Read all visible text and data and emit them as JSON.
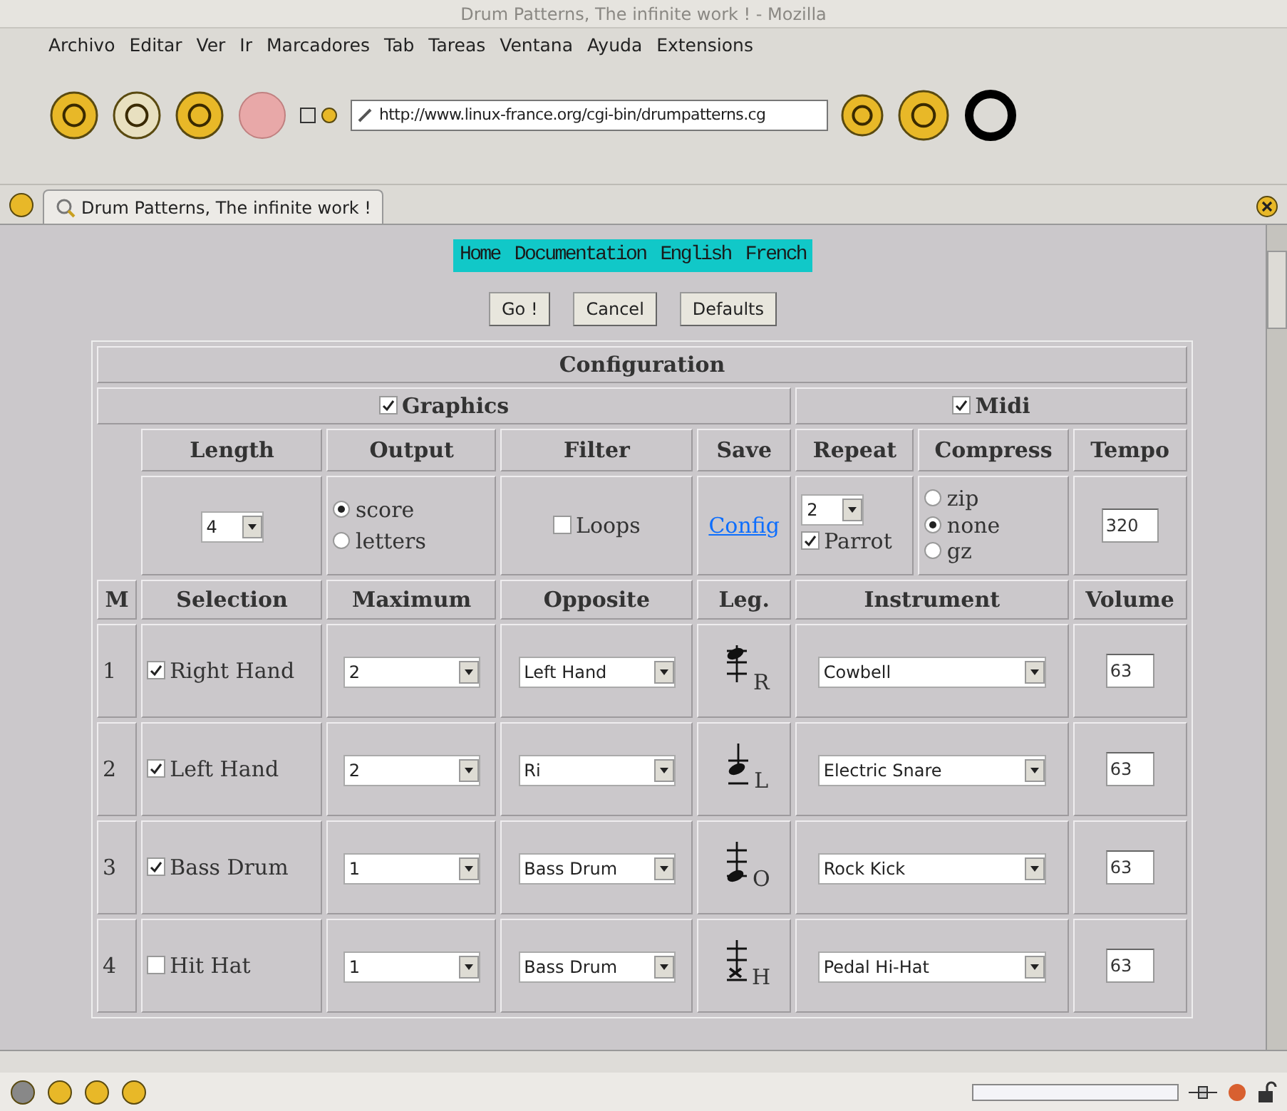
{
  "window": {
    "title": "Drum Patterns, The infinite work ! - Mozilla"
  },
  "menu": [
    "Archivo",
    "Editar",
    "Ver",
    "Ir",
    "Marcadores",
    "Tab",
    "Tareas",
    "Ventana",
    "Ayuda",
    "Extensions"
  ],
  "address_bar": {
    "url": "http://www.linux-france.org/cgi-bin/drumpatterns.cg"
  },
  "tabs": [
    {
      "label": "Drum Patterns, The infinite work !",
      "selected": true
    }
  ],
  "nav_links": [
    "Home",
    "Documentation",
    "English",
    "French"
  ],
  "buttons": [
    "Go !",
    "Cancel",
    "Defaults"
  ],
  "configuration": {
    "title": "Configuration",
    "sections": [
      {
        "label": "Graphics",
        "checked": true
      },
      {
        "label": "Midi",
        "checked": true
      }
    ],
    "columns": [
      "Length",
      "Output",
      "Filter",
      "Save",
      "Repeat",
      "Compress",
      "Tempo"
    ],
    "length": "4",
    "output": [
      {
        "label": "score",
        "selected": true
      },
      {
        "label": "letters",
        "selected": false
      }
    ],
    "filter": {
      "label": "Loops",
      "checked": false
    },
    "save_link": "Config",
    "repeat": "2",
    "parrot": {
      "label": "Parrot",
      "checked": true
    },
    "compress": [
      {
        "label": "zip",
        "selected": false
      },
      {
        "label": "none",
        "selected": true
      },
      {
        "label": "gz",
        "selected": false
      }
    ],
    "tempo": "320"
  },
  "tracks": {
    "columns": [
      "M",
      "Selection",
      "Maximum",
      "Opposite",
      "Leg.",
      "Instrument",
      "Volume"
    ],
    "rows": [
      {
        "number": "1",
        "label": "Right Hand",
        "checked": true,
        "maximum": "2",
        "opposite": "Left Hand",
        "legend": {
          "kind": "upper",
          "letter": "R"
        },
        "instrument": "Cowbell",
        "volume": "63"
      },
      {
        "number": "2",
        "label": "Left Hand",
        "checked": true,
        "maximum": "2",
        "opposite": "Ri",
        "legend": {
          "kind": "middle",
          "letter": "L"
        },
        "instrument": "Electric Snare",
        "volume": "63"
      },
      {
        "number": "3",
        "label": "Bass Drum",
        "checked": true,
        "maximum": "1",
        "opposite": "Bass Drum",
        "legend": {
          "kind": "lower",
          "letter": "O"
        },
        "instrument": "Rock Kick",
        "volume": "63"
      },
      {
        "number": "4",
        "label": "Hit Hat",
        "checked": false,
        "maximum": "1",
        "opposite": "Bass Drum",
        "legend": {
          "kind": "cross",
          "letter": "H"
        },
        "instrument": "Pedal Hi-Hat",
        "volume": "63"
      }
    ]
  }
}
